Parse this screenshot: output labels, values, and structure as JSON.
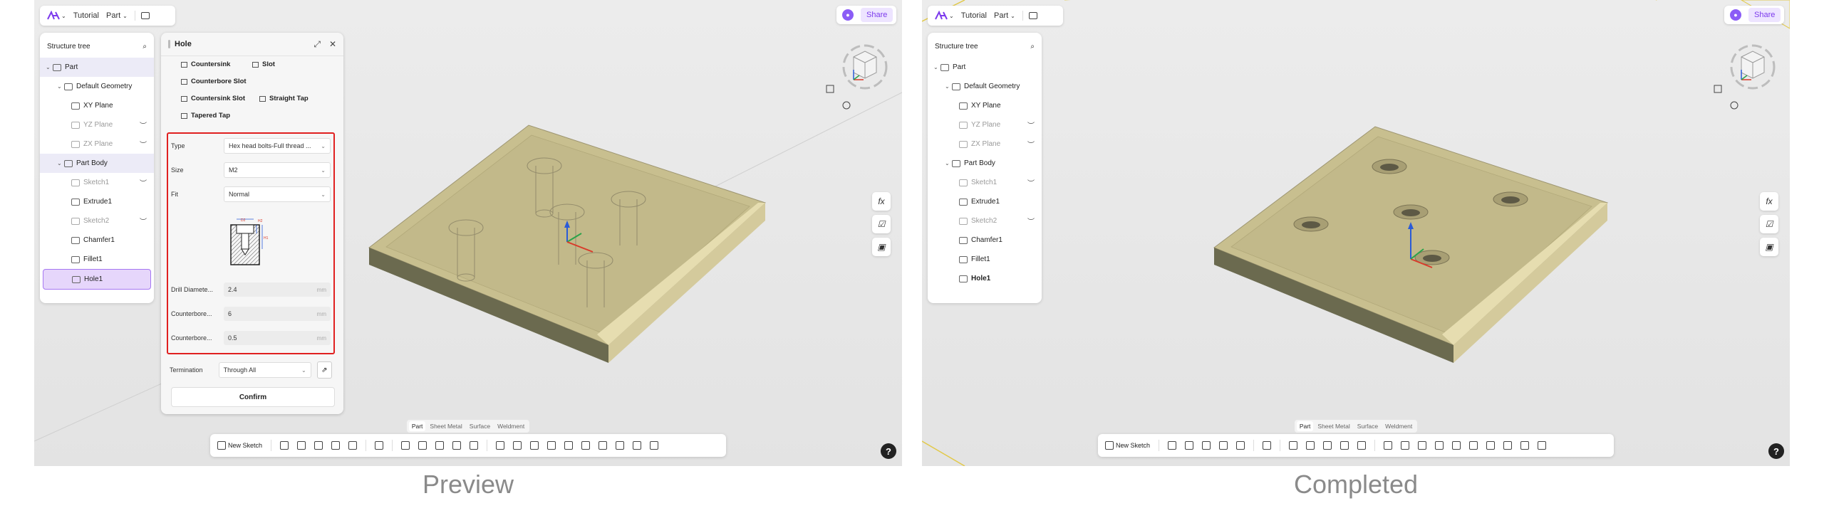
{
  "app": {
    "breadcrumb_tutorial": "Tutorial",
    "breadcrumb_part": "Part",
    "share_label": "Share",
    "accent_color": "#7c3aed"
  },
  "structure_tree": {
    "title": "Structure tree",
    "items": [
      {
        "label": "Part"
      },
      {
        "label": "Default Geometry"
      },
      {
        "label": "XY Plane"
      },
      {
        "label": "YZ Plane"
      },
      {
        "label": "ZX Plane"
      },
      {
        "label": "Part Body"
      },
      {
        "label": "Sketch1"
      },
      {
        "label": "Extrude1"
      },
      {
        "label": "Sketch2"
      },
      {
        "label": "Chamfer1"
      },
      {
        "label": "Fillet1"
      },
      {
        "label": "Hole1"
      }
    ]
  },
  "hole_dialog": {
    "title": "Hole",
    "hole_types": [
      "Countersink",
      "Slot",
      "Counterbore Slot",
      "Countersink Slot",
      "Straight Tap",
      "Tapered Tap"
    ],
    "type_label": "Type",
    "type_value": "Hex head bolts-Full thread ...",
    "size_label": "Size",
    "size_value": "M2",
    "fit_label": "Fit",
    "fit_value": "Normal",
    "diagram_labels": {
      "d2": "D2",
      "h2": "H2",
      "h1": "H1"
    },
    "drill_label": "Drill Diamete...",
    "drill_value": "2.4",
    "cb_diam_label": "Counterbore...",
    "cb_diam_value": "6",
    "cb_depth_label": "Counterbore...",
    "cb_depth_value": "0.5",
    "unit": "mm",
    "termination_label": "Termination",
    "termination_value": "Through All",
    "confirm_label": "Confirm",
    "highlight_color": "#e02020"
  },
  "bottom_tabs": [
    "Part",
    "Sheet Metal",
    "Surface",
    "Weldment"
  ],
  "toolbar": {
    "new_sketch_label": "New Sketch"
  },
  "right_tools": {
    "fx_label": "fx"
  },
  "captions": {
    "left": "Preview",
    "right": "Completed"
  }
}
